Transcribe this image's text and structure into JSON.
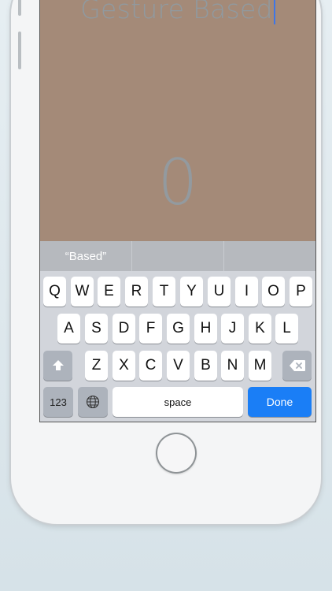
{
  "app": {
    "title_text": "Gesture Based",
    "counter_value": "0",
    "background_color": "#a48a78"
  },
  "suggestions": [
    "“Based”",
    "",
    ""
  ],
  "keyboard": {
    "row1": [
      "Q",
      "W",
      "E",
      "R",
      "T",
      "Y",
      "U",
      "I",
      "O",
      "P"
    ],
    "row2": [
      "A",
      "S",
      "D",
      "F",
      "G",
      "H",
      "J",
      "K",
      "L"
    ],
    "row3": [
      "Z",
      "X",
      "C",
      "V",
      "B",
      "N",
      "M"
    ],
    "numbers_label": "123",
    "space_label": "space",
    "done_label": "Done",
    "done_color": "#1a7ef6"
  }
}
